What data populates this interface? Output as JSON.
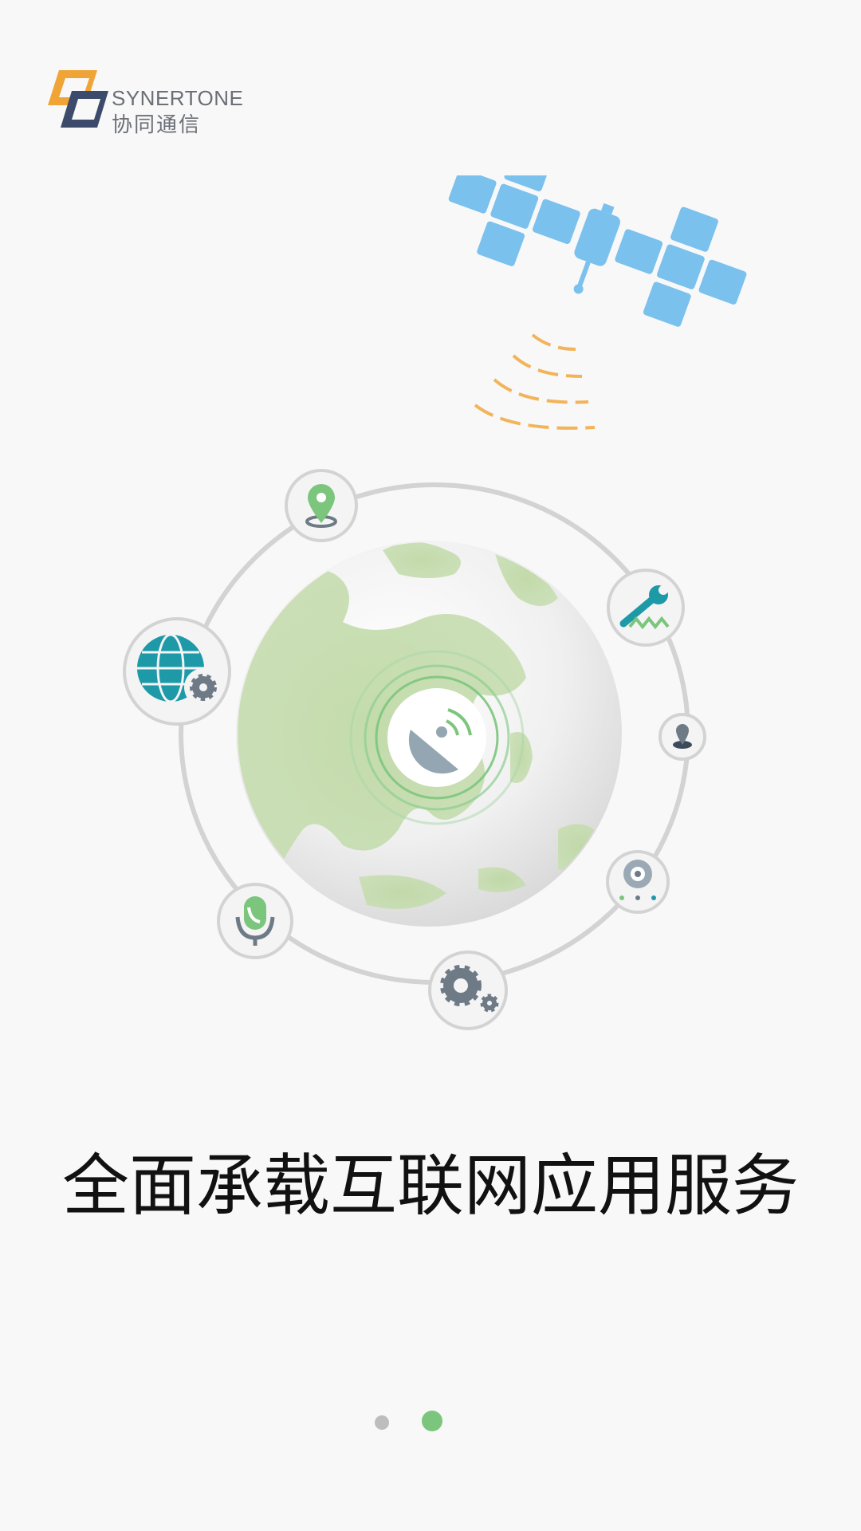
{
  "brand": {
    "name_en": "SYNERTONE",
    "name_cn": "协同通信"
  },
  "headline": "全面承载互联网应用服务",
  "pager": {
    "total": 2,
    "active_index": 1
  },
  "colors": {
    "background": "#f8f8f8",
    "accent_green": "#7cc57d",
    "logo_orange": "#f0a435",
    "logo_navy": "#3c4a6b",
    "satellite_blue": "#7bc1ee",
    "signal_orange": "#f2b45b",
    "ring_gray": "#d3d3d3",
    "icon_teal": "#1d99a8"
  },
  "icons": [
    "location-pin-icon",
    "wrench-icon",
    "person-pin-icon",
    "webcam-icon",
    "settings-gears-icon",
    "voice-call-icon",
    "globe-settings-icon",
    "satellite-dish-icon",
    "satellite-icon"
  ]
}
